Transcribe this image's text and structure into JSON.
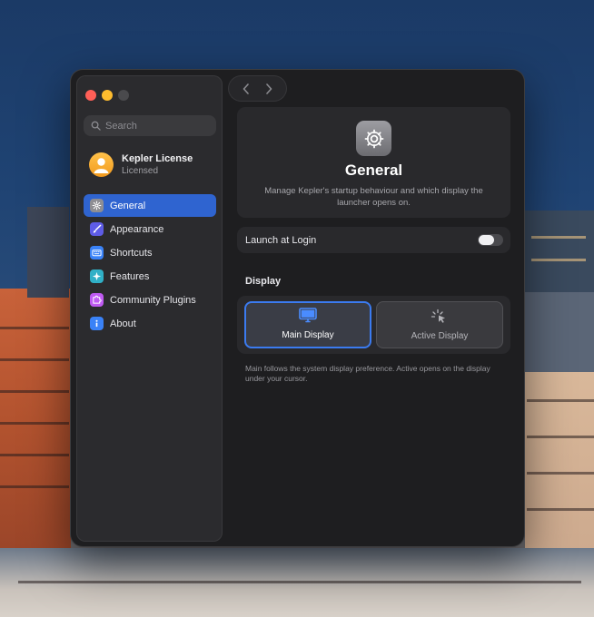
{
  "window": {
    "controls": [
      "close",
      "minimize",
      "zoom"
    ]
  },
  "sidebar": {
    "search": {
      "placeholder": "Search",
      "value": ""
    },
    "license": {
      "name": "Kepler License",
      "status": "Licensed",
      "icon": "person-icon"
    },
    "items": [
      {
        "label": "General",
        "icon": "gear-icon",
        "color": "#8e8e93",
        "active": true
      },
      {
        "label": "Appearance",
        "icon": "paintbrush-icon",
        "color": "#5e5ce6",
        "active": false
      },
      {
        "label": "Shortcuts",
        "icon": "keyboard-icon",
        "color": "#3a82f7",
        "active": false
      },
      {
        "label": "Features",
        "icon": "sparkles-icon",
        "color": "#30b0c7",
        "active": false
      },
      {
        "label": "Community Plugins",
        "icon": "puzzle-icon",
        "color": "#bf5af2",
        "active": false
      },
      {
        "label": "About",
        "icon": "info-icon",
        "color": "#3a82f7",
        "active": false
      }
    ]
  },
  "toolbar": {
    "back_icon": "chevron-left-icon",
    "forward_icon": "chevron-right-icon"
  },
  "main": {
    "hero": {
      "icon": "gear-icon",
      "title": "General",
      "description": "Manage Kepler's startup behaviour and which display the launcher opens on."
    },
    "launch_at_login": {
      "label": "Launch at Login",
      "enabled": false
    },
    "display_section": {
      "title": "Display",
      "options": [
        {
          "label": "Main Display",
          "icon": "monitor-icon",
          "selected": true
        },
        {
          "label": "Active Display",
          "icon": "cursor-icon",
          "selected": false
        }
      ],
      "note": "Main follows the system display preference. Active opens on the display under your cursor."
    }
  },
  "colors": {
    "accent": "#2f64d0",
    "selection_border": "#3b7bf0",
    "window_bg": "#1e1e20"
  }
}
